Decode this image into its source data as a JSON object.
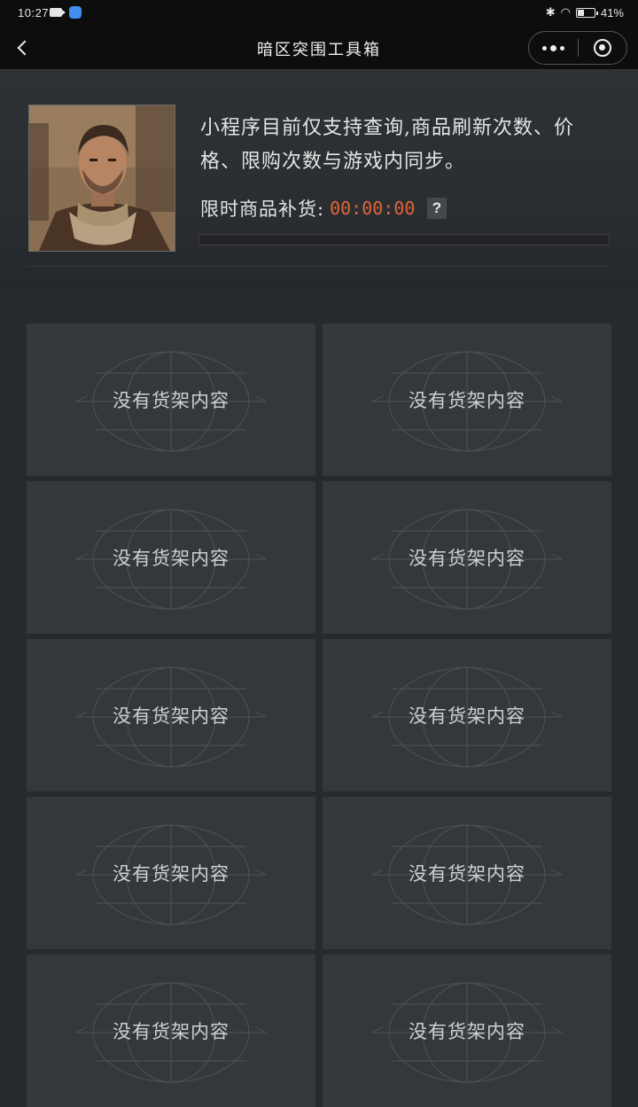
{
  "status_bar": {
    "time": "10:27",
    "battery": "41%",
    "battery_level": 0.41
  },
  "nav": {
    "title": "暗区突围工具箱"
  },
  "header": {
    "notice": "小程序目前仅支持查询,商品刷新次数、价格、限购次数与游戏内同步。",
    "restock_label": "限时商品补货:",
    "restock_time": "00:00:00",
    "help_label": "?",
    "progress": 0
  },
  "shelves": [
    {
      "empty_label": "没有货架内容"
    },
    {
      "empty_label": "没有货架内容"
    },
    {
      "empty_label": "没有货架内容"
    },
    {
      "empty_label": "没有货架内容"
    },
    {
      "empty_label": "没有货架内容"
    },
    {
      "empty_label": "没有货架内容"
    },
    {
      "empty_label": "没有货架内容"
    },
    {
      "empty_label": "没有货架内容"
    },
    {
      "empty_label": "没有货架内容"
    },
    {
      "empty_label": "没有货架内容"
    }
  ],
  "colors": {
    "accent": "#e0643a",
    "background": "#262a2d",
    "card": "#34383b",
    "nav": "#0d0d0d"
  },
  "icons": [
    "back-chevron-icon",
    "more-dots-icon",
    "target-close-icon",
    "camera-icon",
    "shield-icon",
    "bluetooth-icon",
    "wifi-icon",
    "battery-icon"
  ]
}
